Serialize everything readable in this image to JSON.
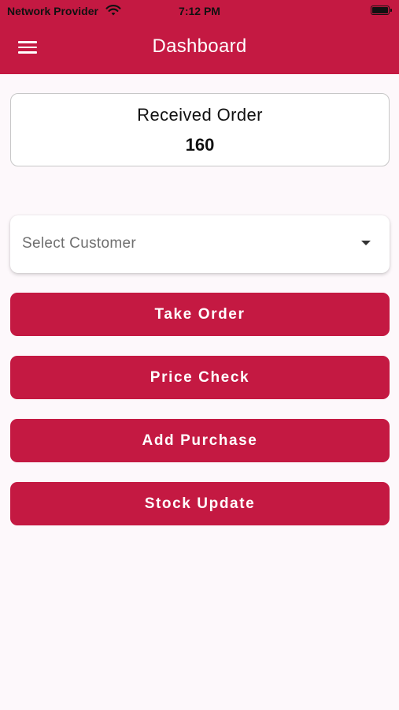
{
  "status_bar": {
    "carrier": "Network Provider",
    "time": "7:12 PM"
  },
  "header": {
    "title": "Dashboard",
    "menu_icon": "hamburger-menu-icon",
    "background": "#c41942"
  },
  "received_order": {
    "label": "Received Order",
    "value": "160"
  },
  "customer_select": {
    "placeholder": "Select Customer",
    "icon": "dropdown-caret-icon"
  },
  "actions": {
    "take_order": "Take Order",
    "price_check": "Price Check",
    "add_purchase": "Add Purchase",
    "stock_update": "Stock Update"
  },
  "colors": {
    "accent": "#c41942",
    "background": "#fdf8fb"
  }
}
